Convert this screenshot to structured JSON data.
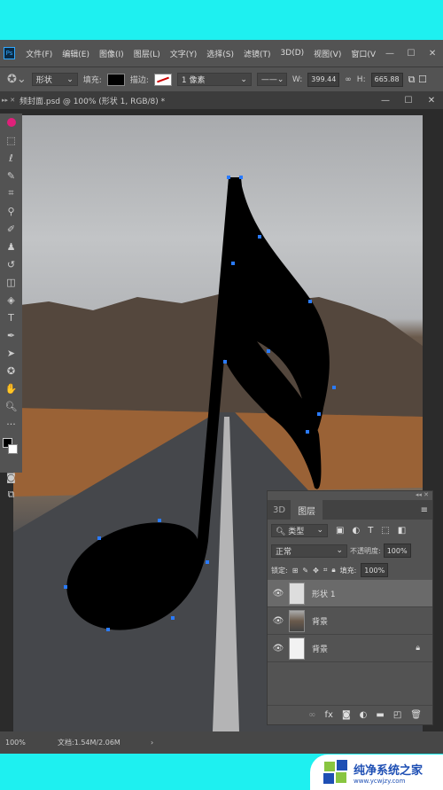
{
  "menu": {
    "items": [
      "文件(F)",
      "编辑(E)",
      "图像(I)",
      "图层(L)",
      "文字(Y)",
      "选择(S)",
      "滤镜(T)",
      "3D(D)",
      "视图(V)",
      "窗口(V"
    ],
    "logo": "Ps"
  },
  "options": {
    "mode": "形状",
    "fill_label": "填充:",
    "fill_color": "#000000",
    "stroke_label": "描边:",
    "stroke_width": "1 像素",
    "w_label": "W:",
    "w_value": "399.44",
    "link": "∞",
    "h_label": "H:",
    "h_value": "665.88"
  },
  "document": {
    "tab_title": "频封面.psd @ 100% (形状 1, RGB/8) *"
  },
  "layers_panel": {
    "tabs": [
      "3D",
      "图层"
    ],
    "filter": "类型",
    "blend_mode": "正常",
    "opacity_label": "不透明度:",
    "opacity": "100%",
    "lock_label": "锁定:",
    "fill_label": "填充:",
    "fill": "100%",
    "layers": [
      {
        "name": "形状 1",
        "selected": true
      },
      {
        "name": "背景",
        "selected": false
      },
      {
        "name": "背景",
        "selected": false,
        "locked": true
      }
    ]
  },
  "status": {
    "zoom": "100%",
    "doc": "文档:1.54M/2.06M"
  },
  "watermark": {
    "name": "纯净系统之家",
    "url": "www.ycwjzy.com"
  }
}
